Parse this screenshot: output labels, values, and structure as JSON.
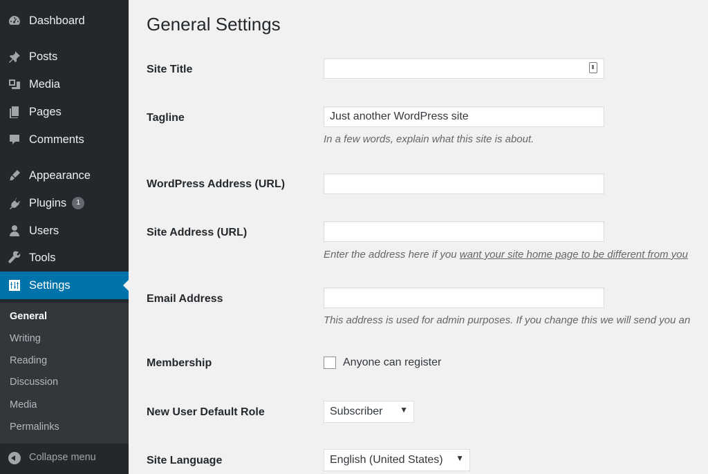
{
  "sidebar": {
    "items": [
      {
        "label": "Dashboard",
        "icon": "dashboard-icon"
      },
      {
        "label": "Posts",
        "icon": "pin-icon"
      },
      {
        "label": "Media",
        "icon": "media-icon"
      },
      {
        "label": "Pages",
        "icon": "pages-icon"
      },
      {
        "label": "Comments",
        "icon": "comment-icon"
      },
      {
        "label": "Appearance",
        "icon": "brush-icon"
      },
      {
        "label": "Plugins",
        "icon": "plugin-icon",
        "badge": "1"
      },
      {
        "label": "Users",
        "icon": "user-icon"
      },
      {
        "label": "Tools",
        "icon": "wrench-icon"
      },
      {
        "label": "Settings",
        "icon": "settings-icon",
        "active": true
      }
    ],
    "submenu": [
      "General",
      "Writing",
      "Reading",
      "Discussion",
      "Media",
      "Permalinks"
    ],
    "collapse_label": "Collapse menu"
  },
  "main": {
    "title": "General Settings",
    "fields": {
      "site_title": {
        "label": "Site Title",
        "value": ""
      },
      "tagline": {
        "label": "Tagline",
        "value": "Just another WordPress site",
        "description": "In a few words, explain what this site is about."
      },
      "wp_address": {
        "label": "WordPress Address (URL)",
        "value": ""
      },
      "site_address": {
        "label": "Site Address (URL)",
        "value": "",
        "description_prefix": "Enter the address here if you ",
        "description_link": "want your site home page to be different from you"
      },
      "email": {
        "label": "Email Address",
        "value": "",
        "description": "This address is used for admin purposes. If you change this we will send you an"
      },
      "membership": {
        "label": "Membership",
        "checkbox_label": "Anyone can register",
        "checked": false
      },
      "default_role": {
        "label": "New User Default Role",
        "value": "Subscriber"
      },
      "language": {
        "label": "Site Language",
        "value": "English (United States)"
      }
    }
  },
  "colors": {
    "sidebar_bg": "#23282d",
    "submenu_bg": "#32373c",
    "accent": "#0073aa",
    "page_bg": "#f1f1f1"
  }
}
